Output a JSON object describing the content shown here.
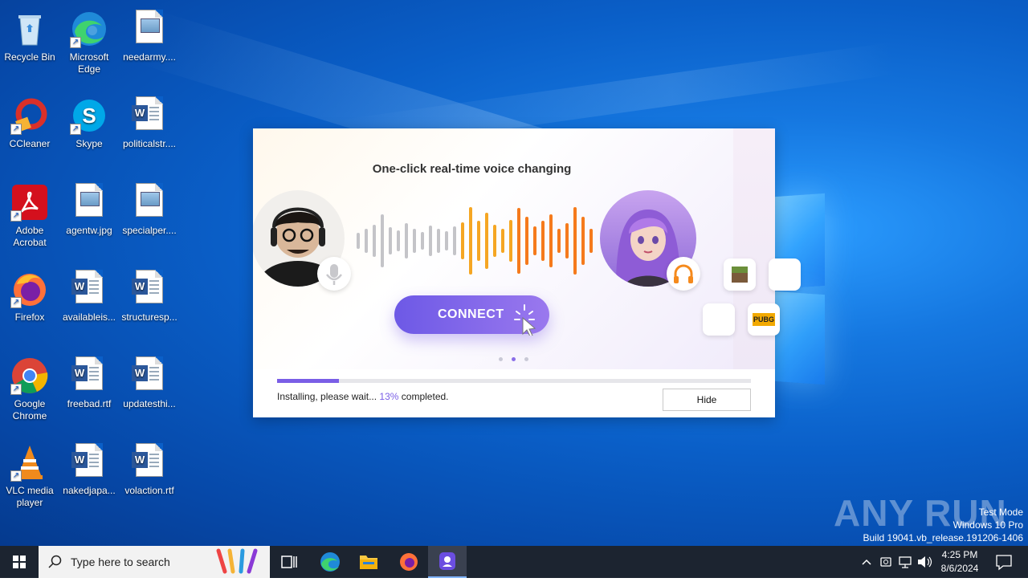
{
  "desktop": {
    "icons": [
      {
        "label": "Recycle Bin",
        "kind": "recycle-bin-icon"
      },
      {
        "label": "Microsoft Edge",
        "kind": "edge-icon"
      },
      {
        "label": "needarmy....",
        "kind": "image-file-icon"
      },
      {
        "label": "CCleaner",
        "kind": "ccleaner-icon"
      },
      {
        "label": "Skype",
        "kind": "skype-icon"
      },
      {
        "label": "politicalstr....",
        "kind": "word-doc-icon"
      },
      {
        "label": "Adobe Acrobat",
        "kind": "acrobat-icon"
      },
      {
        "label": "agentw.jpg",
        "kind": "image-file-icon"
      },
      {
        "label": "specialper....",
        "kind": "image-file-icon"
      },
      {
        "label": "Firefox",
        "kind": "firefox-icon"
      },
      {
        "label": "availableis...",
        "kind": "word-doc-icon"
      },
      {
        "label": "structuresp...",
        "kind": "word-doc-icon"
      },
      {
        "label": "Google Chrome",
        "kind": "chrome-icon"
      },
      {
        "label": "freebad.rtf",
        "kind": "word-doc-icon"
      },
      {
        "label": "updatesthi...",
        "kind": "word-doc-icon"
      },
      {
        "label": "VLC media player",
        "kind": "vlc-icon"
      },
      {
        "label": "nakedjapa...",
        "kind": "word-doc-icon"
      },
      {
        "label": "volaction.rtf",
        "kind": "word-doc-icon"
      }
    ]
  },
  "installer": {
    "banner_title": "One-click real-time voice changing",
    "connect_label": "CONNECT",
    "status_prefix": "Installing, please wait...",
    "progress_percent_text": "13%",
    "progress_fraction": 0.13,
    "status_suffix": "completed.",
    "hide_label": "Hide",
    "game_tile_label": "PUBG",
    "accent_color": "#7a5ee6"
  },
  "watermark": {
    "brand": "ANY RUN",
    "line1": "Test Mode",
    "line2": "Windows 10 Pro",
    "line3": "Build 19041.vb_release.191206-1406"
  },
  "taskbar": {
    "search_placeholder": "Type here to search",
    "time": "4:25 PM",
    "date": "8/6/2024",
    "pinned": [
      "task-view-icon",
      "edge-icon",
      "file-explorer-icon",
      "firefox-icon",
      "voice-changer-app-icon"
    ]
  }
}
